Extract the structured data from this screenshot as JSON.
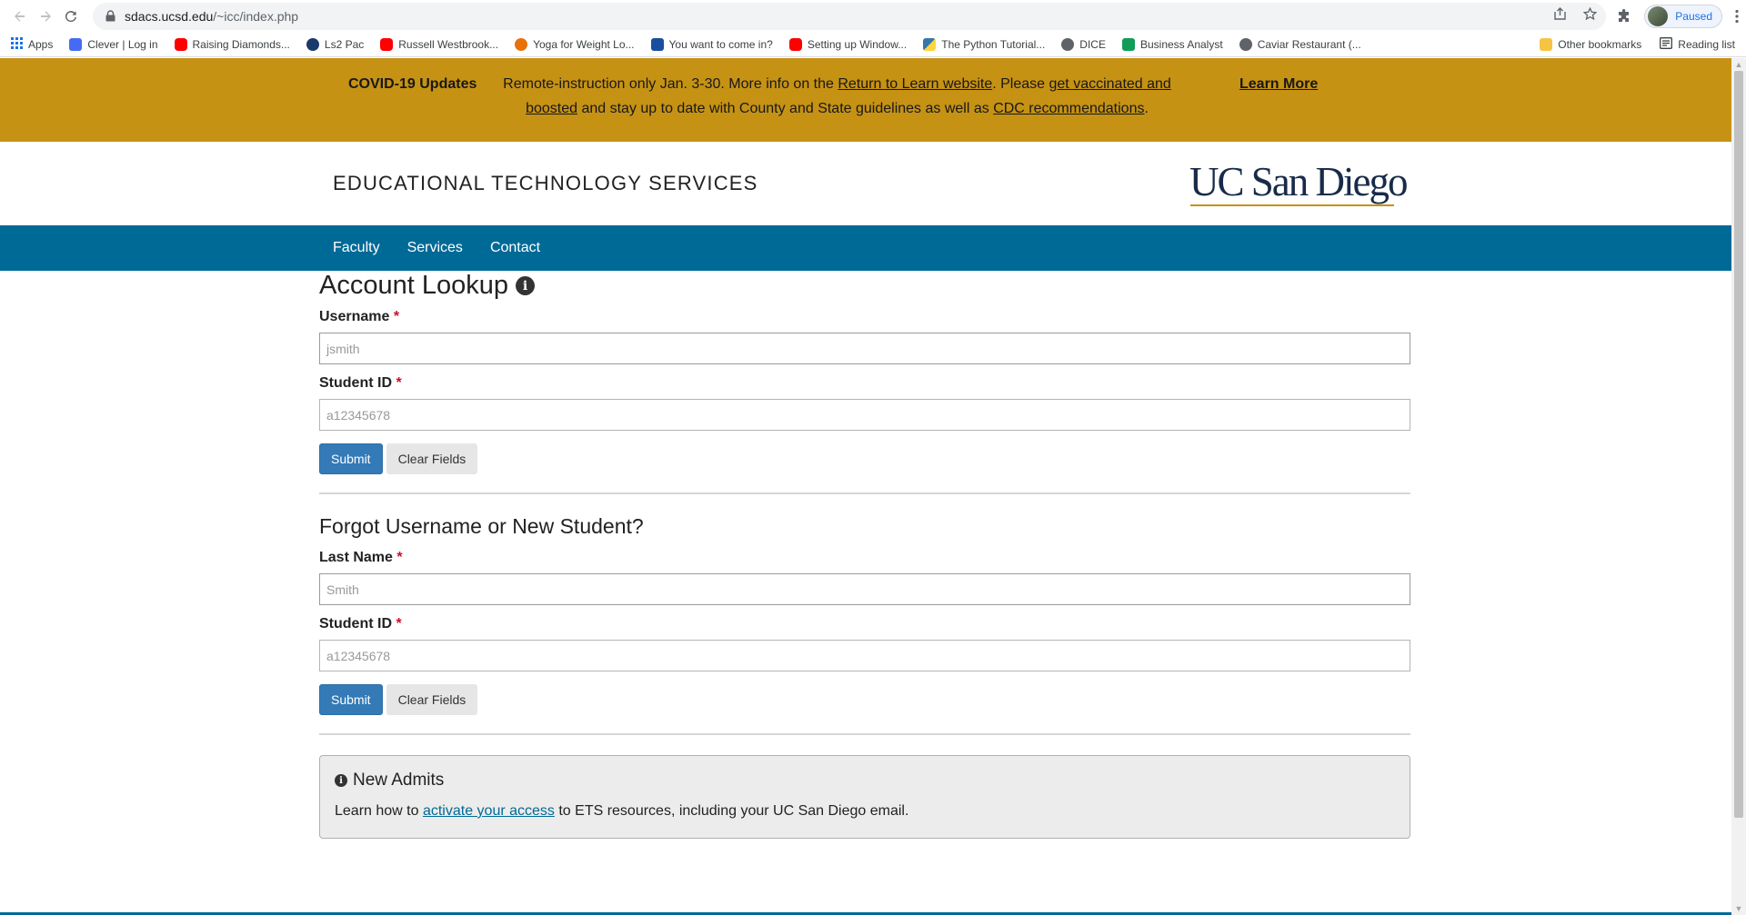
{
  "browser": {
    "url_host": "sdacs.ucsd.edu",
    "url_path": "/~icc/index.php",
    "profile_status": "Paused",
    "bookmarks": [
      {
        "label": "Apps",
        "icon": "apps-grid-icon",
        "color": "#1a73e8"
      },
      {
        "label": "Clever | Log in",
        "icon": "clever-icon",
        "color": "#436cf2"
      },
      {
        "label": "Raising Diamonds...",
        "icon": "youtube-icon",
        "color": "#ff0000"
      },
      {
        "label": "Ls2 Pac",
        "icon": "globe-icon",
        "color": "#1b3a6b"
      },
      {
        "label": "Russell Westbrook...",
        "icon": "youtube-icon",
        "color": "#ff0000"
      },
      {
        "label": "Yoga for Weight Lo...",
        "icon": "yoga-icon",
        "color": "#e8710a"
      },
      {
        "label": "You want to come in?",
        "icon": "five-icon",
        "color": "#1a4fa0"
      },
      {
        "label": "Setting up Window...",
        "icon": "youtube-icon",
        "color": "#ff0000"
      },
      {
        "label": "The Python Tutorial...",
        "icon": "python-icon",
        "color": "#3776ab"
      },
      {
        "label": "DICE",
        "icon": "globe-icon",
        "color": "#5f6368"
      },
      {
        "label": "Business Analyst",
        "icon": "sheets-icon",
        "color": "#0f9d58"
      },
      {
        "label": "Caviar Restaurant (...",
        "icon": "globe-icon",
        "color": "#5f6368"
      }
    ],
    "other_bookmarks": "Other bookmarks",
    "reading_list": "Reading list"
  },
  "covid": {
    "title": "COVID-19 Updates",
    "msg_1": "Remote-instruction only Jan. 3-30. More info on the ",
    "link_return": "Return to Learn website",
    "msg_2": ". Please ",
    "link_vaccinated": "get vaccinated and boosted",
    "msg_3": " and stay up to date with County and State guidelines as well as ",
    "link_cdc": "CDC recommendations",
    "msg_4": ".",
    "learn_more": "Learn More"
  },
  "header": {
    "department": "EDUCATIONAL TECHNOLOGY SERVICES",
    "logo_text": "UC San Diego"
  },
  "nav": {
    "items": [
      "Faculty",
      "Services",
      "Contact"
    ]
  },
  "lookup": {
    "title": "Account Lookup",
    "username_label": "Username",
    "username_placeholder": "jsmith",
    "student_id_label": "Student ID",
    "student_id_placeholder": "a12345678",
    "submit": "Submit",
    "clear": "Clear Fields"
  },
  "forgot": {
    "title": "Forgot Username or New Student?",
    "last_name_label": "Last Name",
    "last_name_placeholder": "Smith",
    "student_id_label": "Student ID",
    "student_id_placeholder": "a12345678",
    "submit": "Submit",
    "clear": "Clear Fields"
  },
  "admits": {
    "title": "New Admits",
    "text_1": "Learn how to ",
    "link": "activate your access",
    "text_2": " to ETS resources, including your UC San Diego email."
  },
  "required_mark": "*",
  "colors": {
    "covid_bar": "#c69214",
    "nav_bar": "#006a96",
    "logo_navy": "#182b49",
    "submit_blue": "#337ab7",
    "required_red": "#c8102e"
  }
}
